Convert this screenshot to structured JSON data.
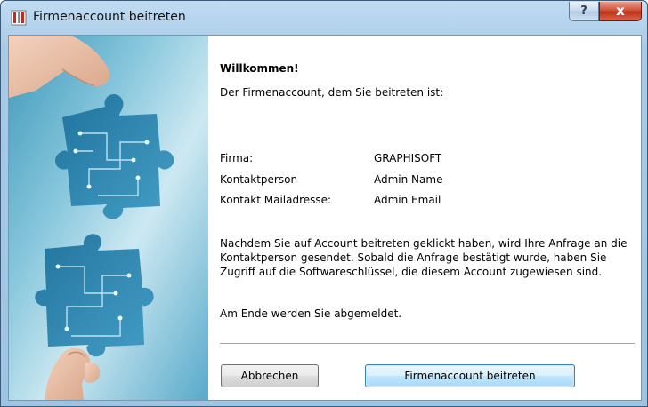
{
  "window": {
    "title": "Firmenaccount beitreten",
    "help_label": "?",
    "close_label": "x"
  },
  "content": {
    "heading": "Willkommen!",
    "intro": "Der Firmenaccount, dem Sie beitreten ist:",
    "details": [
      {
        "label": "Firma:",
        "value": "GRAPHISOFT"
      },
      {
        "label": "Kontaktperson",
        "value": "Admin Name"
      },
      {
        "label": "Kontakt Mailadresse:",
        "value": "Admin Email"
      }
    ],
    "info_paragraph": "Nachdem Sie auf Account beitreten geklickt haben, wird Ihre Anfrage an die Kontaktperson gesendet. Sobald die Anfrage bestätigt wurde, haben Sie Zugriff auf die Softwareschlüssel, die diesem Account zugewiesen sind.",
    "logout_note": "Am Ende werden Sie abgemeldet."
  },
  "buttons": {
    "cancel": "Abbrechen",
    "join": "Firmenaccount beitreten"
  },
  "colors": {
    "title_bar": "#a9cbe8",
    "close_button": "#c7381f",
    "primary_button": "#bee6fd"
  },
  "icons": {
    "app": "app-window-icon",
    "illustration": "puzzle-hands-image"
  }
}
